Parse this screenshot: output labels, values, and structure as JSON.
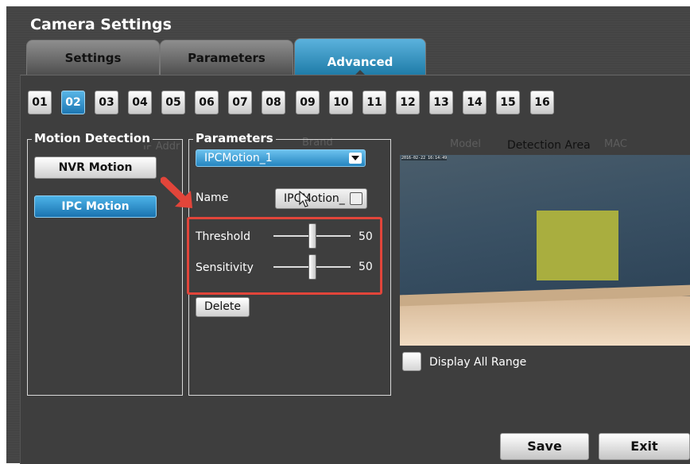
{
  "window": {
    "title": "Camera Settings"
  },
  "tabs": [
    {
      "label": "Settings",
      "active": false
    },
    {
      "label": "Parameters",
      "active": false
    },
    {
      "label": "Advanced",
      "active": true
    }
  ],
  "channels": {
    "items": [
      "01",
      "02",
      "03",
      "04",
      "05",
      "06",
      "07",
      "08",
      "09",
      "10",
      "11",
      "12",
      "13",
      "14",
      "15",
      "16"
    ],
    "selected": "02"
  },
  "motion_detection": {
    "title": "Motion Detection",
    "nvr_label": "NVR Motion",
    "ipc_label": "IPC Motion",
    "selected": "IPC Motion"
  },
  "parameters": {
    "title": "Parameters",
    "preset_value": "IPCMotion_1",
    "name_label": "Name",
    "name_value": "IPCMotion_",
    "threshold_label": "Threshold",
    "threshold_value": "50",
    "threshold_level": 50,
    "sensitivity_label": "Sensitivity",
    "sensitivity_value": "50",
    "sensitivity_level": 50,
    "delete_label": "Delete"
  },
  "detection": {
    "title": "Detection Area",
    "timestamp": "2016-02-22 16:14:49",
    "display_all_label": "Display All Range",
    "area_color": "#a9ae3f"
  },
  "background_ghost": {
    "ip_address": "IP Addr",
    "brand": "Brand",
    "model": "Model",
    "mac": "MAC"
  },
  "actions": {
    "save_label": "Save",
    "exit_label": "Exit"
  },
  "annotations": {
    "highlight_color": "#e2453a"
  },
  "colors": {
    "accent": "#2a8cc6",
    "panel": "#3e3e3e"
  }
}
